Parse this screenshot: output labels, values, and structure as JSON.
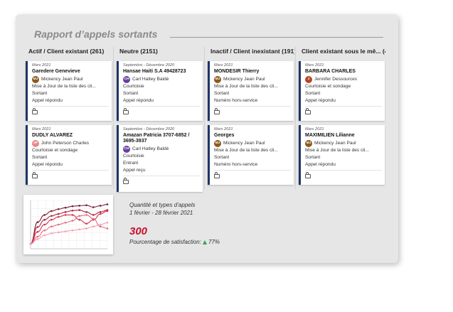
{
  "report": {
    "title": "Rapport d’appels sortants"
  },
  "columns": [
    {
      "label": "Actif / Client existant",
      "count": "(261)",
      "cards": [
        {
          "date": "Mars 2021",
          "name": "Garedere Genevieve",
          "avatar_initials": "MJ",
          "avatar_color": "#8a5a1e",
          "user": "Mickency Jean Paul",
          "task": "Mise à Jour de la liste des cli...",
          "direction": "Sortant",
          "result": "Appel répondu"
        },
        {
          "date": "Mars 2021",
          "name": "DUDLY ALVAREZ",
          "avatar_initials": "JP",
          "avatar_color": "#e88a8a",
          "user": "John Peterson Charles",
          "task": "Courtoisie et sondage",
          "direction": "Sortant",
          "result": "Appel répondu"
        }
      ]
    },
    {
      "label": "Neutre",
      "count": "(2151)",
      "cards": [
        {
          "date": "Septembre - Décembre 2020",
          "name": "Hansae Haiti S.A 49428723",
          "avatar_initials": "CH",
          "avatar_color": "#6a3fa0",
          "user": "Carl Hatley Baldé",
          "task": "Courtoisie",
          "direction": "Sortant",
          "result": "Appel répondu"
        },
        {
          "date": "Septembre - Décembre 2020",
          "name": "Amazan Patricia 3707-6852 / 3695-3937",
          "avatar_initials": "CH",
          "avatar_color": "#6a3fa0",
          "user": "Carl Hatley Baldé",
          "task": "Courtoisie",
          "direction": "Entrant",
          "result": "Appel reçu"
        }
      ]
    },
    {
      "label": "Inactif / Client inexistant",
      "count": "(191)",
      "cards": [
        {
          "date": "Mars 2021",
          "name": "MONDESIR Thierry",
          "avatar_initials": "MJ",
          "avatar_color": "#8a5a1e",
          "user": "Mickency Jean Paul",
          "task": "Mise à Jour de la liste des cli...",
          "direction": "Sortant",
          "result": "Numéro hors-service"
        },
        {
          "date": "Mars 2021",
          "name": "Georges",
          "avatar_initials": "MJ",
          "avatar_color": "#8a5a1e",
          "user": "Mickency Jean Paul",
          "task": "Mise à Jour de la liste des cli...",
          "direction": "Sortant",
          "result": "Numéro hors-service"
        }
      ]
    },
    {
      "label": "Client existant sous le mê...",
      "count": "(4)",
      "cards": [
        {
          "date": "Mars 2021",
          "name": "BARBARA CHARLES",
          "avatar_initials": "J",
          "avatar_color": "#b5482a",
          "user": "Jennifer Dessources",
          "task": "Courtoisie et sondage",
          "direction": "Sortant",
          "result": "Appel répondu"
        },
        {
          "date": "Mars 2021",
          "name": "MAXIMILIEN Lilianne",
          "avatar_initials": "MJ",
          "avatar_color": "#8a5a1e",
          "user": "Mickency Jean Paul",
          "task": "Mise à Jour de la liste des cli...",
          "direction": "Sortant",
          "result": "Appel répondu"
        }
      ]
    }
  ],
  "stats": {
    "subtitle": "Quantité et types d’appels",
    "period": "1 février - 28 février 2021",
    "total": "300",
    "satisfaction_label": "Pourcentage de satisfaction:",
    "satisfaction_value": "77%",
    "trend_color": "#2da84a",
    "accent_color": "#c8102e"
  },
  "chart_data": {
    "type": "line",
    "x": [
      1,
      2,
      3,
      4,
      5,
      6,
      7,
      8,
      9,
      10,
      11,
      12
    ],
    "ylim": [
      0,
      10
    ],
    "grid": true,
    "series": [
      {
        "color": "#7a1f35",
        "values": [
          1.0,
          5.5,
          7.0,
          7.8,
          8.2,
          8.5,
          8.8,
          8.9,
          9.0,
          8.6,
          8.9,
          9.2
        ]
      },
      {
        "color": "#b0243f",
        "values": [
          1.0,
          4.5,
          6.0,
          6.8,
          7.2,
          7.6,
          7.9,
          8.0,
          7.6,
          7.0,
          7.6,
          8.0
        ]
      },
      {
        "color": "#d8344f",
        "values": [
          1.0,
          3.5,
          5.0,
          6.0,
          6.6,
          7.0,
          7.0,
          6.0,
          5.2,
          6.0,
          7.2,
          7.8
        ]
      },
      {
        "color": "#e86a80",
        "values": [
          1.0,
          2.5,
          3.8,
          4.6,
          5.0,
          5.4,
          5.8,
          6.8,
          7.0,
          6.2,
          4.6,
          4.2
        ]
      },
      {
        "color": "#f3a0b0",
        "values": [
          1.0,
          2.0,
          2.8,
          3.2,
          3.4,
          3.6,
          3.8,
          4.0,
          4.2,
          4.6,
          5.0,
          5.4
        ]
      }
    ]
  }
}
